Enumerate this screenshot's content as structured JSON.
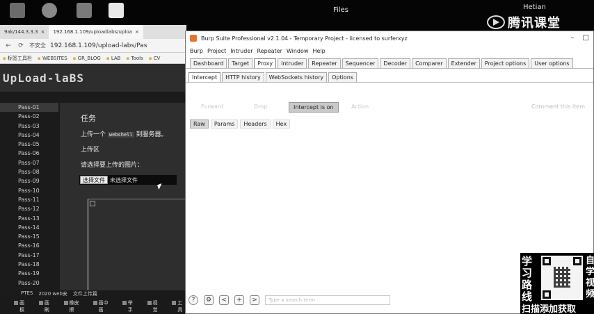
{
  "desktop": {
    "files_label": "Files",
    "user_label": "Hetian",
    "brand_text": "腾讯课堂",
    "icons": [
      {
        "name": "computer-icon",
        "label": ""
      },
      {
        "name": "shield-icon",
        "label": ""
      },
      {
        "name": "app-icon",
        "label": ""
      },
      {
        "name": "document-icon",
        "label": ""
      }
    ]
  },
  "browser": {
    "tabs": [
      "9ak/144.3.3.3",
      "192.168.1.109/uploadlabs/uploa"
    ],
    "address_warning": "不安全",
    "address_url": "192.168.1.109/upload-labs/Pas",
    "bookmarks": [
      "标签工具栏",
      "WEBSITES",
      "GR_BLOG",
      "LAB",
      "Tools",
      "CV"
    ],
    "site_logo": "UpLoad-laBS",
    "passes": [
      "Pass-01",
      "Pass-02",
      "Pass-03",
      "Pass-04",
      "Pass-05",
      "Pass-06",
      "Pass-07",
      "Pass-08",
      "Pass-09",
      "Pass-10",
      "Pass-11",
      "Pass-12",
      "Pass-13",
      "Pass-14",
      "Pass-15",
      "Pass-16",
      "Pass-17",
      "Pass-18",
      "Pass-19",
      "Pass-20"
    ],
    "task_title": "任务",
    "task_desc_prefix": "上传一个",
    "task_desc_code": "webshell",
    "task_desc_suffix": "到服务器。",
    "upload_title": "上传区",
    "select_label": "请选择要上传的图片：",
    "file_button": "选择文件",
    "file_none": "未选择文件"
  },
  "taskbar": {
    "pts_items": [
      "PTES",
      "2020 web安",
      "文件上传篇"
    ],
    "items": [
      "画板",
      "画刷",
      "橡皮擦",
      "画中画",
      "举手",
      "视觉",
      "工具"
    ]
  },
  "burp": {
    "title": "Burp Suite Professional v2.1.04 - Temporary Project - licensed to surferxyz",
    "menu": [
      "Burp",
      "Project",
      "Intruder",
      "Repeater",
      "Window",
      "Help"
    ],
    "tabs": [
      "Dashboard",
      "Target",
      "Proxy",
      "Intruder",
      "Repeater",
      "Sequencer",
      "Decoder",
      "Comparer",
      "Extender",
      "Project options",
      "User options"
    ],
    "active_tab": "Proxy",
    "subtabs": [
      "Intercept",
      "HTTP history",
      "WebSockets history",
      "Options"
    ],
    "active_subtab": "Intercept",
    "buttons": {
      "forward": "Forward",
      "drop": "Drop",
      "intercept": "Intercept is on",
      "action": "Action"
    },
    "comment_placeholder": "Comment this item",
    "msg_tabs": [
      "Raw",
      "Params",
      "Headers",
      "Hex"
    ],
    "bottom": {
      "help": "?",
      "back": "<",
      "add": "+",
      "next": ">",
      "search_placeholder": "Type a search term"
    }
  },
  "ad": {
    "vertical_text": "学习路线",
    "right_text": "自学视频",
    "bottom_text": "扫描添加获取"
  },
  "colors": {
    "burp_accent": "#e8742c",
    "intercept_btn": "#c9c9c9"
  }
}
